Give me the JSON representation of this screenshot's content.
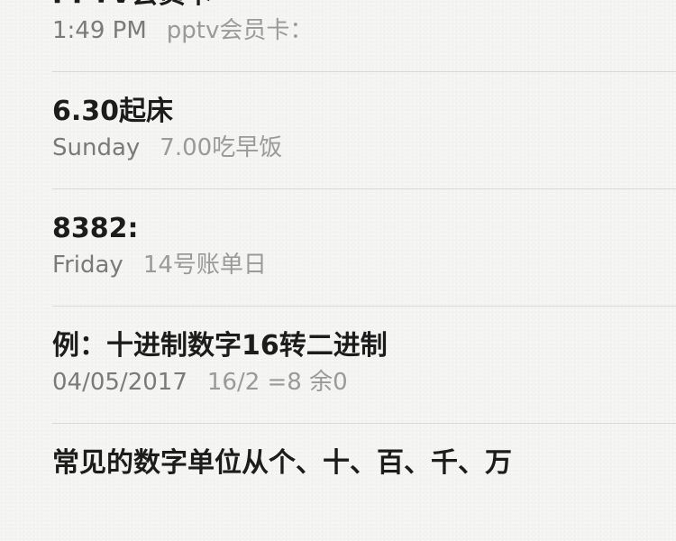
{
  "notes": [
    {
      "title": "PPTV会员卡",
      "date": "1:49 PM",
      "preview": "pptv会员卡："
    },
    {
      "title": "6.30起床",
      "date": "Sunday",
      "preview": "7.00吃早饭"
    },
    {
      "title": "8382:",
      "date": "Friday",
      "preview": "14号账单日"
    },
    {
      "title": "例：十进制数字16转二进制",
      "date": "04/05/2017",
      "preview": "16/2 =8 余0"
    },
    {
      "title": "常见的数字单位从个、十、百、千、万",
      "date": "",
      "preview": ""
    }
  ]
}
